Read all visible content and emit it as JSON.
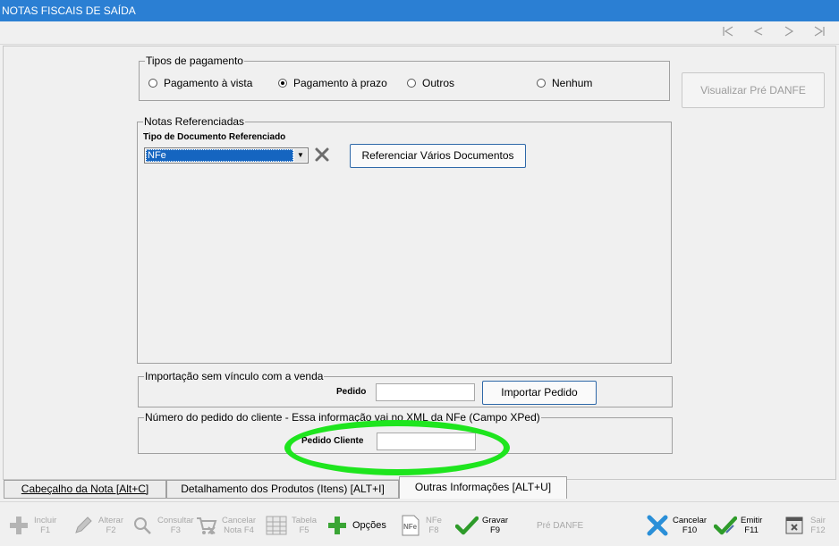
{
  "window": {
    "title": "NOTAS FISCAIS DE SAÍDA"
  },
  "nav": {
    "first_icon": "first-record-icon",
    "prev_icon": "previous-record-icon",
    "next_icon": "next-record-icon",
    "last_icon": "last-record-icon"
  },
  "pagamento": {
    "legend": "Tipos de pagamento",
    "options": [
      {
        "label": "Pagamento à vista",
        "selected": false
      },
      {
        "label": "Pagamento à prazo",
        "selected": true
      },
      {
        "label": "Outros",
        "selected": false
      },
      {
        "label": "Nenhum",
        "selected": false
      }
    ]
  },
  "visualizar_button": "Visualizar Pré DANFE",
  "referenciadas": {
    "legend": "Notas Referenciadas",
    "tipo_label": "Tipo de Documento Referenciado",
    "tipo_value": "NFe",
    "referenciar_button": "Referenciar Vários Documentos"
  },
  "importacao": {
    "legend": "Importação sem vínculo com a venda",
    "pedido_label": "Pedido",
    "pedido_value": "",
    "importar_button": "Importar Pedido"
  },
  "pedido_cliente": {
    "legend": "Número do pedido do cliente - Essa informação vai no XML da NFe (Campo XPed)",
    "label": "Pedido Cliente",
    "value": ""
  },
  "annotation_color": "#1ee51e",
  "tabs": [
    {
      "label": "Cabeçalho da Nota  [Alt+C]",
      "active": false
    },
    {
      "label": "Detalhamento dos Produtos (Itens)  [ALT+I]",
      "active": false
    },
    {
      "label": "Outras Informações [ALT+U]",
      "active": true
    }
  ],
  "toolbar": {
    "incluir": {
      "line1": "Incluir",
      "line2": "F1",
      "icon": "plus-icon"
    },
    "alterar": {
      "line1": "Alterar",
      "line2": "F2",
      "icon": "pencil-icon"
    },
    "consultar": {
      "line1": "Consultar",
      "line2": "F3",
      "icon": "magnifier-icon"
    },
    "cancelar_nota": {
      "line1": "Cancelar",
      "line2": "Nota F4",
      "icon": "cart-cancel-icon"
    },
    "tabela": {
      "line1": "Tabela",
      "line2": "F5",
      "icon": "table-icon"
    },
    "opcoes": {
      "line1": "Opções",
      "icon": "plus-green-icon"
    },
    "nfe": {
      "line1": "NFe",
      "line2": "F8",
      "icon": "nfe-document-icon"
    },
    "gravar": {
      "line1": "Gravar",
      "line2": "F9",
      "icon": "check-icon"
    },
    "pre_danfe": {
      "line1": "Pré DANFE"
    },
    "cancelar": {
      "line1": "Cancelar",
      "line2": "F10",
      "icon": "x-icon"
    },
    "emitir": {
      "line1": "Emitir",
      "line2": "F11",
      "icon": "check-icon"
    },
    "sair": {
      "line1": "Sair",
      "line2": "F12",
      "icon": "exit-icon"
    }
  }
}
